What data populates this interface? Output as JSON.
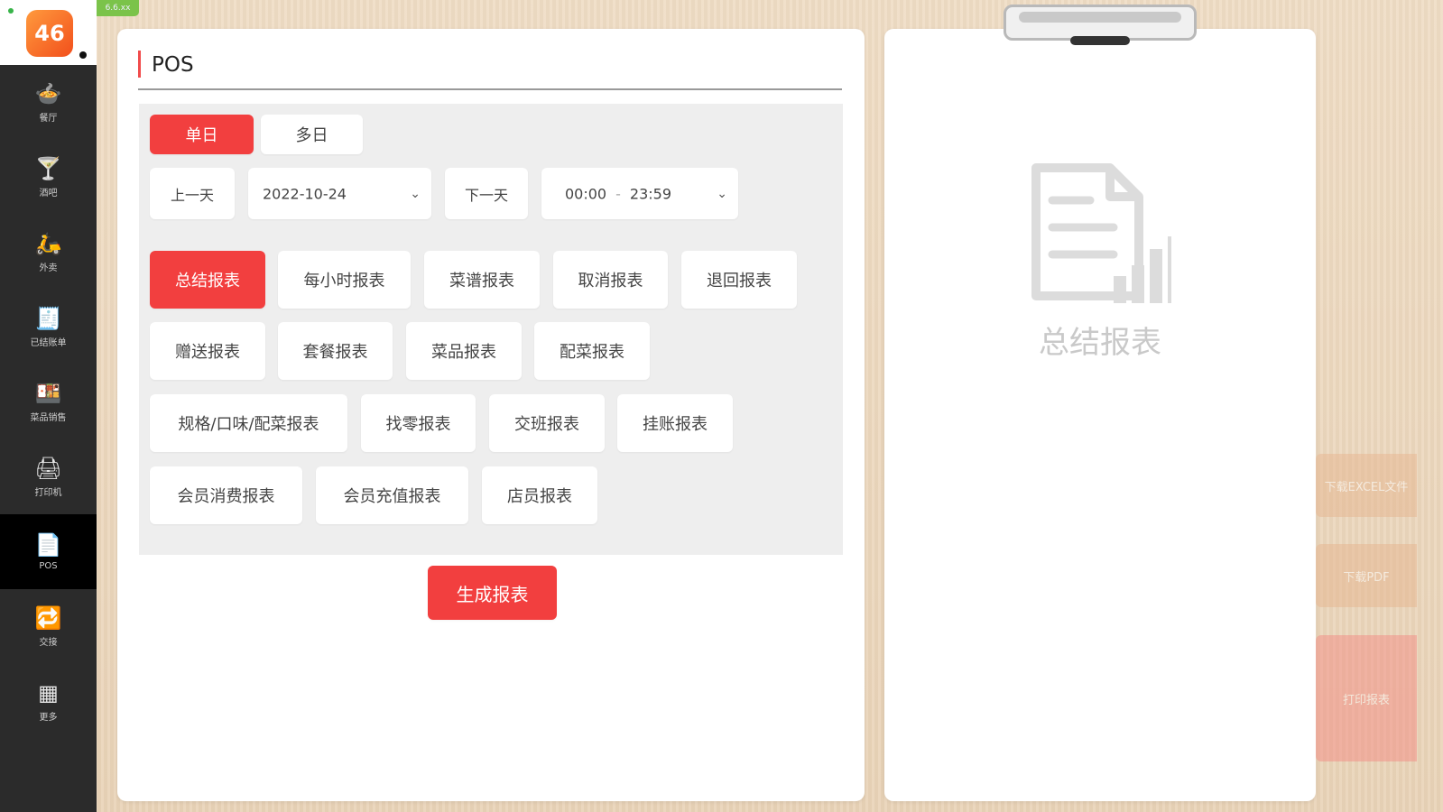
{
  "app": {
    "logo_text": "46",
    "version": "6.6.xx"
  },
  "sidebar": {
    "items": [
      {
        "label": "餐厅",
        "icon": "cloche-icon",
        "glyph": "🍲",
        "active": false
      },
      {
        "label": "酒吧",
        "icon": "cocktail-icon",
        "glyph": "🍸",
        "active": false
      },
      {
        "label": "外卖",
        "icon": "delivery-icon",
        "glyph": "🛵",
        "active": false
      },
      {
        "label": "已结账单",
        "icon": "receipt-icon",
        "glyph": "🧾",
        "active": false
      },
      {
        "label": "菜品销售",
        "icon": "dish-icon",
        "glyph": "🍱",
        "active": false
      },
      {
        "label": "打印机",
        "icon": "printer-icon",
        "glyph": "🖨",
        "active": false
      },
      {
        "label": "POS",
        "icon": "document-icon",
        "glyph": "📄",
        "active": true
      },
      {
        "label": "交接",
        "icon": "exchange-icon",
        "glyph": "🔁",
        "active": false
      },
      {
        "label": "更多",
        "icon": "grid-icon",
        "glyph": "▦",
        "active": false
      }
    ]
  },
  "main": {
    "title": "POS",
    "mode_tabs": [
      {
        "label": "单日",
        "active": true
      },
      {
        "label": "多日",
        "active": false
      }
    ],
    "prev_day_label": "上一天",
    "date_value": "2022-10-24",
    "next_day_label": "下一天",
    "time_start": "00:00",
    "time_separator": "-",
    "time_end": "23:59",
    "report_types": [
      {
        "label": "总结报表",
        "active": true
      },
      {
        "label": "每小时报表",
        "active": false
      },
      {
        "label": "菜谱报表",
        "active": false
      },
      {
        "label": "取消报表",
        "active": false
      },
      {
        "label": "退回报表",
        "active": false
      },
      {
        "label": "赠送报表",
        "active": false
      },
      {
        "label": "套餐报表",
        "active": false
      },
      {
        "label": "菜品报表",
        "active": false
      },
      {
        "label": "配菜报表",
        "active": false
      },
      {
        "label": "规格/口味/配菜报表",
        "active": false
      },
      {
        "label": "找零报表",
        "active": false
      },
      {
        "label": "交班报表",
        "active": false
      },
      {
        "label": "挂账报表",
        "active": false
      },
      {
        "label": "会员消费报表",
        "active": false
      },
      {
        "label": "会员充值报表",
        "active": false
      },
      {
        "label": "店员报表",
        "active": false
      }
    ],
    "generate_label": "生成报表"
  },
  "preview": {
    "placeholder_text": "总结报表"
  },
  "side_actions": [
    {
      "label": "下载EXCEL文件"
    },
    {
      "label": "下载PDF"
    },
    {
      "label": "打印报表"
    }
  ],
  "colors": {
    "accent": "#f23f3f",
    "sidebar_bg": "#2b2b2b"
  }
}
